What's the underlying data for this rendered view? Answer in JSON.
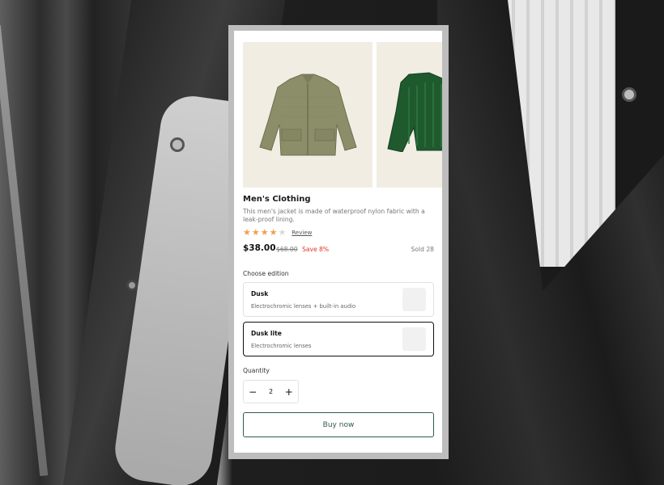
{
  "product": {
    "title": "Men's Clothing",
    "description": "This men's jacket is made of waterproof nylon fabric with a leak-proof lining.",
    "rating": 4,
    "rating_max": 5,
    "review_link": "Review",
    "price": "$38.00",
    "old_price": "$68.00",
    "save": "Save 8%",
    "sold": "Sold 28"
  },
  "gallery": {
    "images": [
      {
        "icon": "olive-jacket-image"
      },
      {
        "icon": "green-sweater-image"
      }
    ]
  },
  "edition": {
    "label": "Choose edition",
    "options": [
      {
        "name": "Dusk",
        "detail": "Electrochromic lenses + built-in audio",
        "selected": false
      },
      {
        "name": "Dusk lite",
        "detail": "Electrochromic lenses",
        "selected": true
      }
    ]
  },
  "quantity": {
    "label": "Quantity",
    "value": "2",
    "minus": "−",
    "plus": "+"
  },
  "actions": {
    "buy_label": "Buy now"
  },
  "colors": {
    "accent": "#2f5a52",
    "save": "#e0352b",
    "star": "#f0a04b"
  }
}
